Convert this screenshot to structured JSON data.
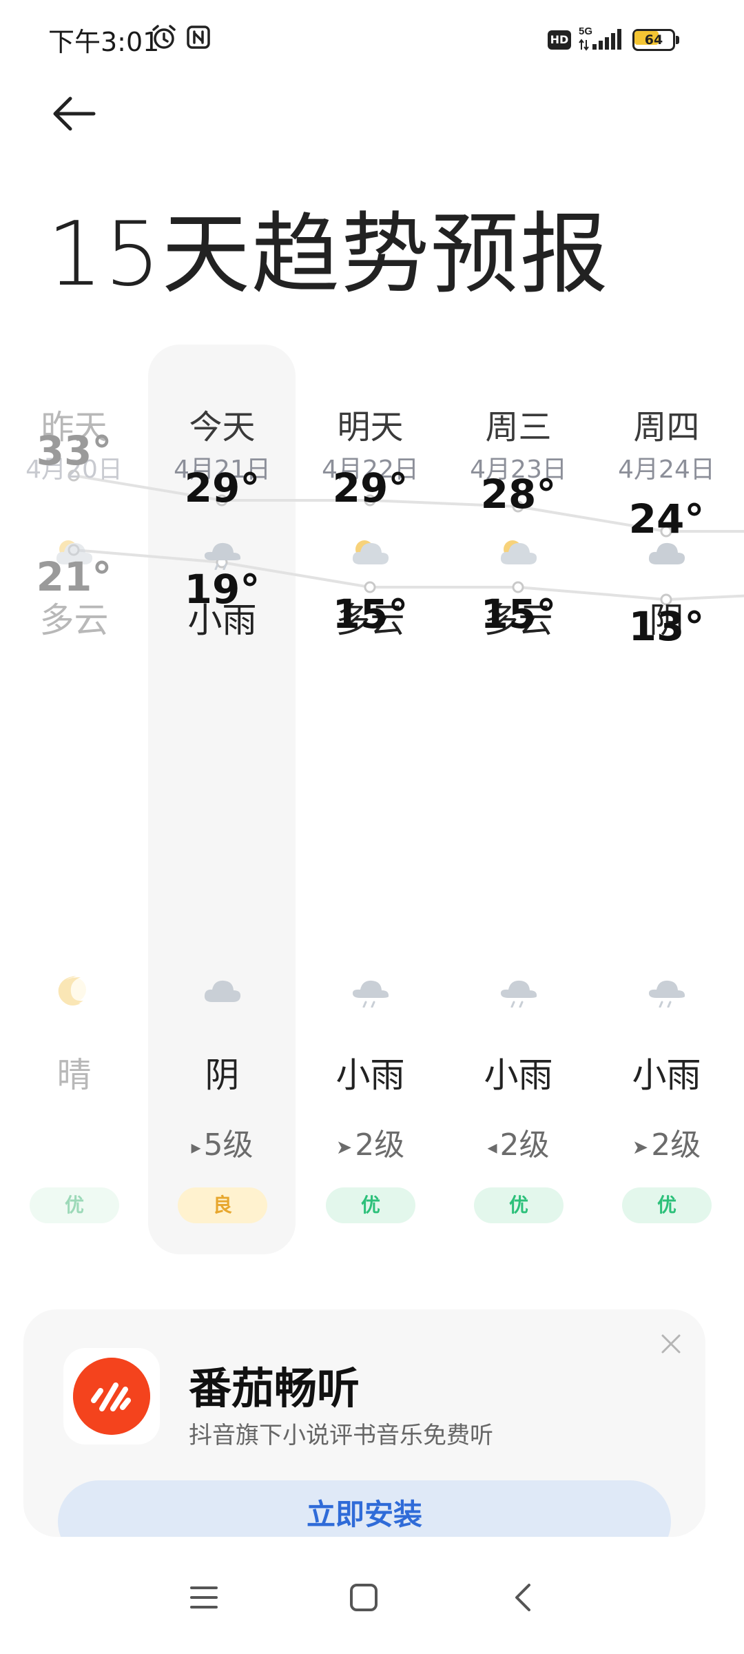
{
  "status_bar": {
    "time": "下午3:01",
    "network": "5G",
    "battery": "64",
    "battery_level": 0.64,
    "icons": [
      "alarm-icon",
      "nfc-icon",
      "hd-icon",
      "signal-icon",
      "battery-icon"
    ]
  },
  "header": {
    "title": "15天趋势预报"
  },
  "forecast": {
    "days": [
      {
        "name": "昨天",
        "date": "4月20日",
        "day_cond": "多云",
        "day_icon": "partly-cloudy-icon",
        "high": "33°",
        "low": "21°",
        "night_icon": "moon-icon",
        "night_cond": "晴",
        "wind": "",
        "aqi": "优",
        "past": true
      },
      {
        "name": "今天",
        "date": "4月21日",
        "day_cond": "小雨",
        "day_icon": "light-rain-icon",
        "high": "29°",
        "low": "19°",
        "night_icon": "cloud-icon",
        "night_cond": "阴",
        "wind": "5级",
        "aqi": "良",
        "past": false
      },
      {
        "name": "明天",
        "date": "4月22日",
        "day_cond": "多云",
        "day_icon": "partly-cloudy-icon",
        "high": "29°",
        "low": "15°",
        "night_icon": "light-rain-icon",
        "night_cond": "小雨",
        "wind": "2级",
        "aqi": "优",
        "past": false
      },
      {
        "name": "周三",
        "date": "4月23日",
        "day_cond": "多云",
        "day_icon": "partly-cloudy-icon",
        "high": "28°",
        "low": "15°",
        "night_icon": "light-rain-icon",
        "night_cond": "小雨",
        "wind": "2级",
        "aqi": "优",
        "past": false
      },
      {
        "name": "周四",
        "date": "4月24日",
        "day_cond": "阴",
        "day_icon": "cloud-icon",
        "high": "24°",
        "low": "13°",
        "night_icon": "light-rain-icon",
        "night_cond": "小雨",
        "wind": "2级",
        "aqi": "优",
        "past": false
      }
    ]
  },
  "chart_data": {
    "type": "line",
    "x": [
      "4月20日",
      "4月21日",
      "4月22日",
      "4月23日",
      "4月24日"
    ],
    "series": [
      {
        "values": [
          33,
          29,
          29,
          28,
          24
        ]
      },
      {
        "values": [
          21,
          19,
          15,
          15,
          13
        ]
      }
    ]
  },
  "ad": {
    "title": "番茄畅听",
    "subtitle": "抖音旗下小说评书音乐免费听",
    "install_label": "立即安装"
  },
  "colors": {
    "accent": "#2f6bd8",
    "aqi_good": "#2cc07a",
    "aqi_fair": "#e7a72e",
    "ad_brand": "#f4431d"
  }
}
